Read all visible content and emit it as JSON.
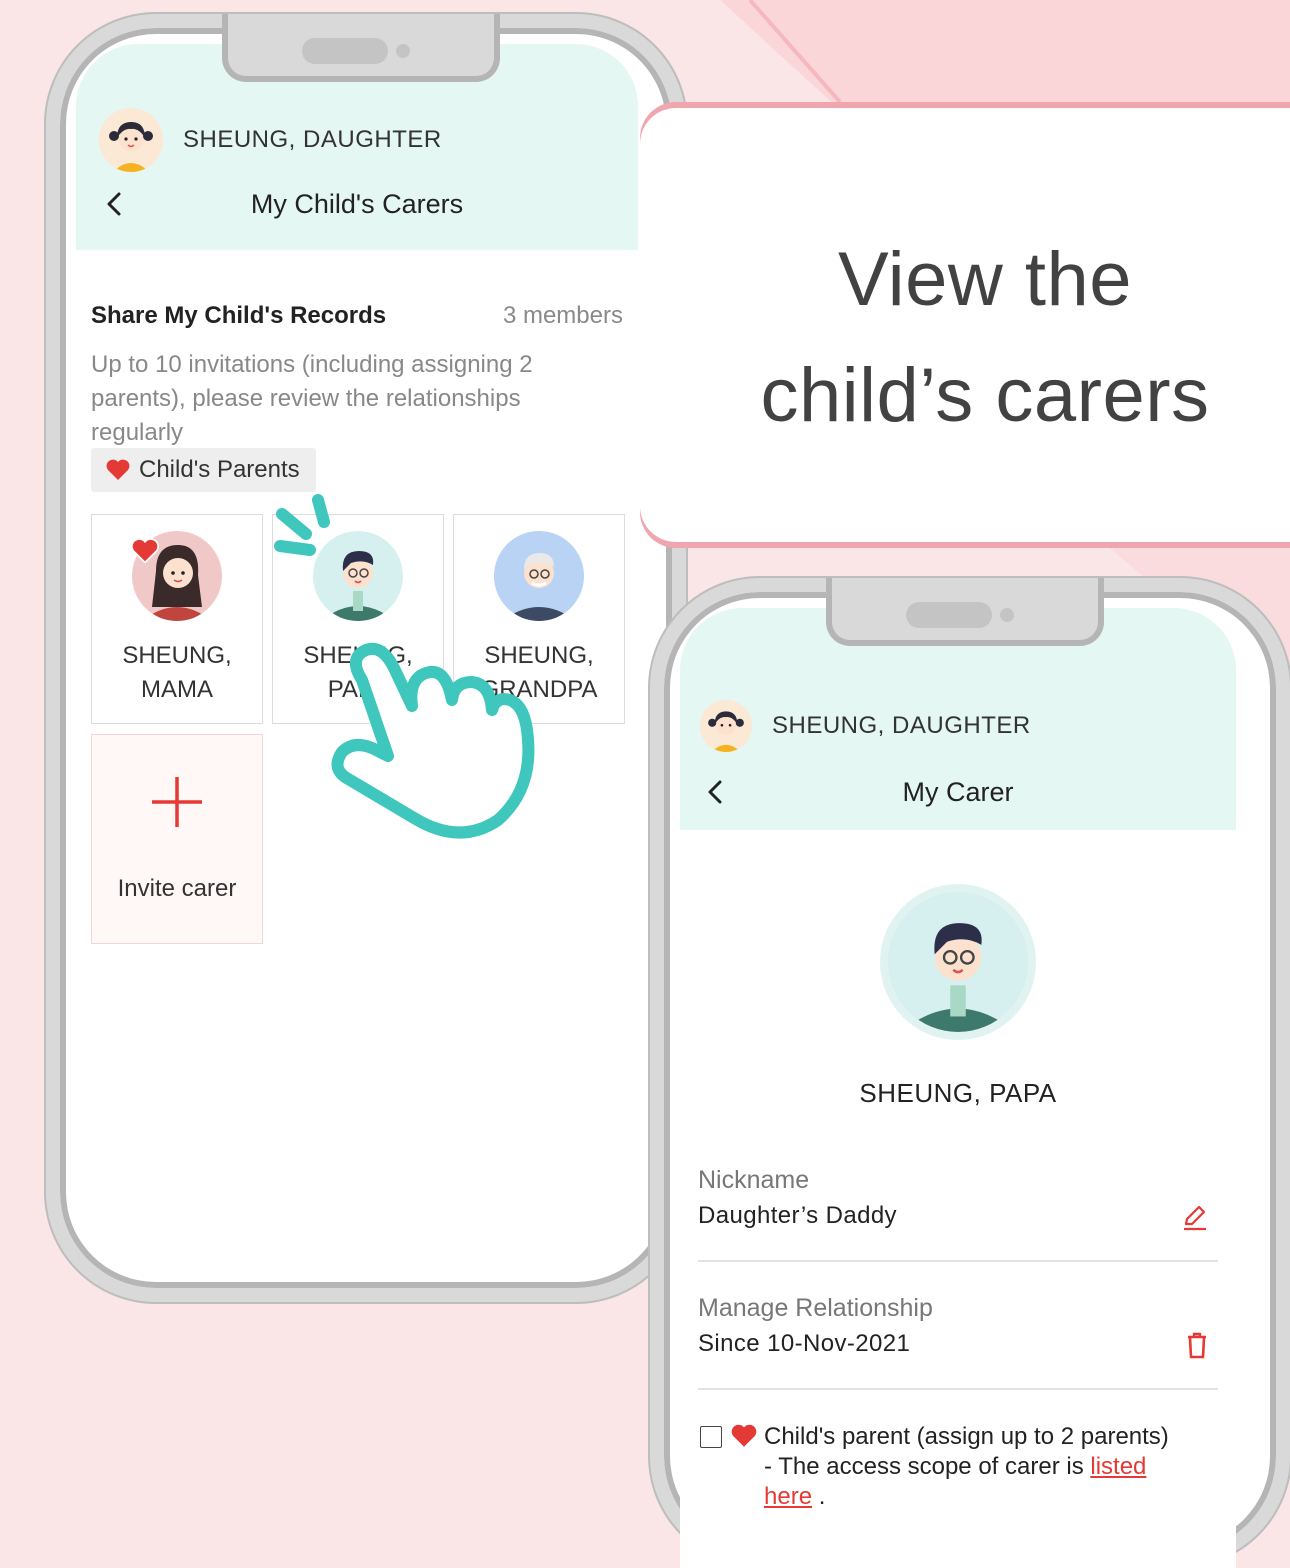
{
  "colors": {
    "accent_red": "#e53935",
    "mint_header": "#e5f7f3",
    "hand_teal": "#3fc6bd"
  },
  "phone1": {
    "user_name": "SHEUNG, DAUGHTER",
    "title": "My Child's Carers",
    "section_title": "Share My Child's Records",
    "member_count": "3 members",
    "description": "Up to 10 invitations (including assigning 2 parents), please review the relationships regularly",
    "parents_tag": "Child's Parents",
    "carers": [
      {
        "line1": "SHEUNG,",
        "line2": "MAMA"
      },
      {
        "line1": "SHEUNG,",
        "line2": "PAPA"
      },
      {
        "line1": "SHEUNG,",
        "line2": "GRANDPA"
      }
    ],
    "invite_label": "Invite carer"
  },
  "banner": {
    "line1": "View the",
    "line2": "child’s carers"
  },
  "phone2": {
    "user_name": "SHEUNG, DAUGHTER",
    "title": "My Carer",
    "carer_name": "SHEUNG, PAPA",
    "nickname_label": "Nickname",
    "nickname_value": "Daughter’s Daddy",
    "relationship_label": "Manage Relationship",
    "relationship_value": "Since 10-Nov-2021",
    "parent_check_text": "Child's parent (assign up to 2 parents)",
    "access_text": "- The access scope of carer is",
    "access_link1": "listed",
    "access_link2": "here",
    "access_end": "."
  },
  "icons": [
    "back-icon",
    "heart-icon",
    "plus-icon",
    "pencil-icon",
    "trash-icon",
    "checkbox-icon",
    "pointing-hand-icon"
  ]
}
